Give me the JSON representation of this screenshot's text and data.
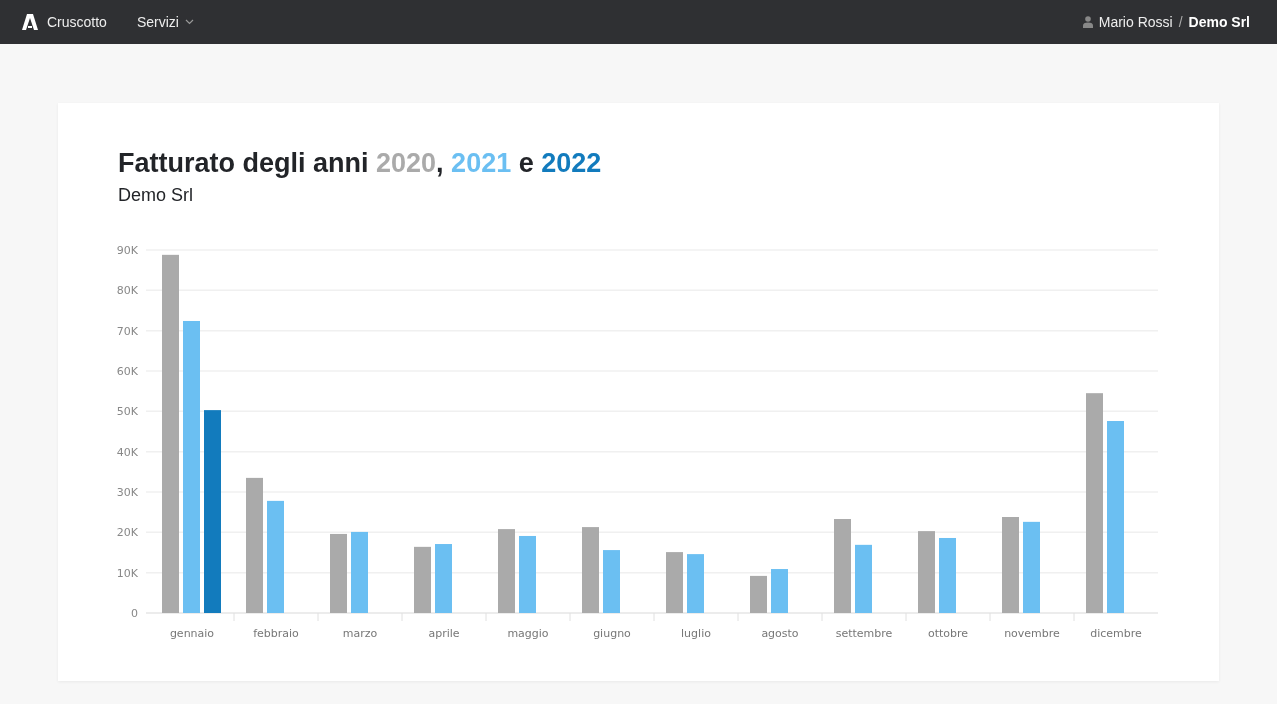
{
  "navbar": {
    "brand": "Cruscotto",
    "menu": [
      {
        "label": "Servizi",
        "kind": "dropdown"
      }
    ],
    "user": "Mario Rossi",
    "separator": "/",
    "company": "Demo Srl"
  },
  "card": {
    "title": {
      "prefix": "Fatturato degli anni ",
      "joiners": [
        ", ",
        " e "
      ]
    },
    "subtitle": "Demo Srl",
    "chart_data": {
      "type": "bar",
      "categories": [
        "gennaio",
        "febbraio",
        "marzo",
        "aprile",
        "maggio",
        "giugno",
        "luglio",
        "agosto",
        "settembre",
        "ottobre",
        "novembre",
        "dicembre"
      ],
      "series": [
        {
          "name": "2020",
          "color": "#aaaaaa",
          "values": [
            88800,
            33500,
            19600,
            16400,
            20800,
            21300,
            15100,
            9200,
            23300,
            20300,
            23800,
            54500
          ]
        },
        {
          "name": "2021",
          "color": "#6bbff2",
          "values": [
            72400,
            27800,
            20100,
            17100,
            19100,
            15600,
            14600,
            10900,
            16900,
            18600,
            22600,
            47600
          ]
        },
        {
          "name": "2022",
          "color": "#127bbd",
          "values": [
            50300,
            null,
            null,
            null,
            null,
            null,
            null,
            null,
            null,
            null,
            null,
            null
          ]
        }
      ],
      "ylim": [
        0,
        90000
      ],
      "grid": true,
      "yticks": [
        {
          "value": 0,
          "label": "0"
        },
        {
          "value": 10000,
          "label": "10K"
        },
        {
          "value": 20000,
          "label": "20K"
        },
        {
          "value": 30000,
          "label": "30K"
        },
        {
          "value": 40000,
          "label": "40K"
        },
        {
          "value": 50000,
          "label": "50K"
        },
        {
          "value": 60000,
          "label": "60K"
        },
        {
          "value": 70000,
          "label": "70K"
        },
        {
          "value": 80000,
          "label": "80K"
        },
        {
          "value": 90000,
          "label": "90K"
        }
      ]
    }
  }
}
